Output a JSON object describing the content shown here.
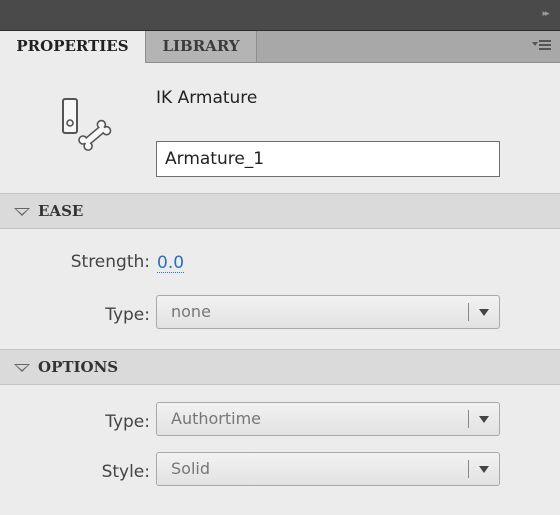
{
  "panel": {
    "collapse_glyph": "▸▸",
    "tabs": [
      {
        "label": "PROPERTIES",
        "active": true
      },
      {
        "label": "LIBRARY",
        "active": false
      }
    ],
    "menu_icon": "panel-menu-icon"
  },
  "object": {
    "icon": "ik-armature-icon",
    "type_label": "IK Armature",
    "name_value": "Armature_1"
  },
  "ease": {
    "title": "EASE",
    "strength_label": "Strength:",
    "strength_value": "0.0",
    "type_label": "Type:",
    "type_value": "none"
  },
  "options": {
    "title": "OPTIONS",
    "type_label": "Type:",
    "type_value": "Authortime",
    "style_label": "Style:",
    "style_value": "Solid"
  },
  "colors": {
    "accent_link": "#2f6fbf",
    "panel_bg": "#ececec",
    "topbar": "#4a4a4a"
  }
}
